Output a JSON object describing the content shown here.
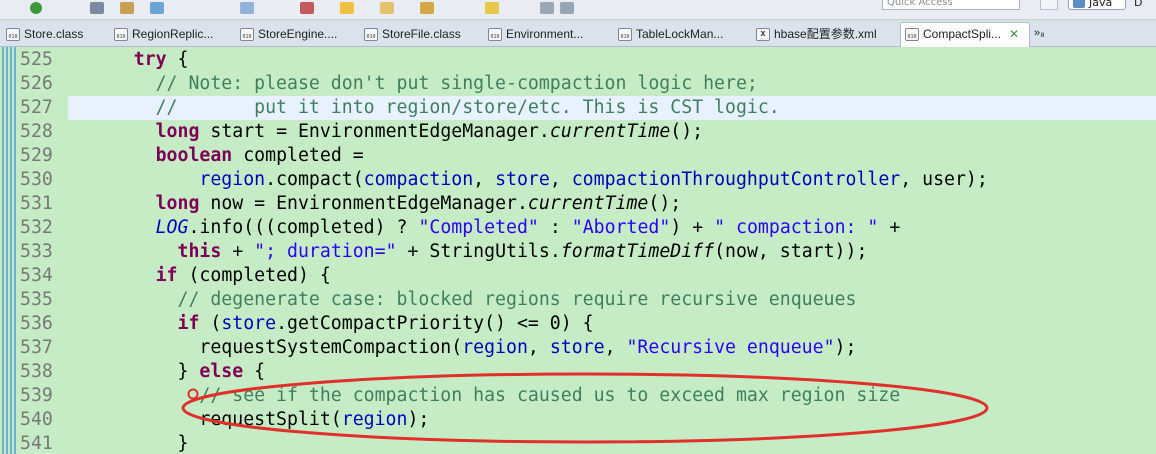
{
  "toolbar": {
    "quick_access_placeholder": "Quick Access",
    "perspective": "Java",
    "perspective_more": "D"
  },
  "tabs": [
    {
      "label": "Store.class",
      "icon": "class-file-icon",
      "active": false
    },
    {
      "label": "RegionReplic...",
      "icon": "class-file-icon",
      "active": false
    },
    {
      "label": "StoreEngine....",
      "icon": "class-file-icon",
      "active": false
    },
    {
      "label": "StoreFile.class",
      "icon": "class-file-icon",
      "active": false
    },
    {
      "label": "Environment...",
      "icon": "class-file-icon",
      "active": false
    },
    {
      "label": "TableLockMan...",
      "icon": "class-file-icon",
      "active": false
    },
    {
      "label": "hbase配置参数.xml",
      "icon": "xml-file-icon",
      "active": false
    },
    {
      "label": "CompactSpli...",
      "icon": "class-file-icon",
      "active": true
    }
  ],
  "tab_overflow": "»₈",
  "tab_icon_text": "010",
  "tab_close_glyph": "✕",
  "editor": {
    "current_line": 527,
    "lines": [
      {
        "n": "525",
        "segs": [
          [
            "pl",
            "      "
          ],
          [
            "kw",
            "try"
          ],
          [
            "pl",
            " {"
          ]
        ]
      },
      {
        "n": "526",
        "segs": [
          [
            "pl",
            "        "
          ],
          [
            "cm",
            "// Note: please don't put single-compaction logic here;"
          ]
        ]
      },
      {
        "n": "527",
        "segs": [
          [
            "pl",
            "        "
          ],
          [
            "cm",
            "//       put it into region/store/etc. This is CST logic."
          ]
        ]
      },
      {
        "n": "528",
        "segs": [
          [
            "pl",
            "        "
          ],
          [
            "kw",
            "long"
          ],
          [
            "pl",
            " start = EnvironmentEdgeManager."
          ],
          [
            "it",
            "currentTime"
          ],
          [
            "pl",
            "();"
          ]
        ]
      },
      {
        "n": "529",
        "segs": [
          [
            "pl",
            "        "
          ],
          [
            "kw",
            "boolean"
          ],
          [
            "pl",
            " completed ="
          ]
        ]
      },
      {
        "n": "530",
        "segs": [
          [
            "pl",
            "            "
          ],
          [
            "fld",
            "region"
          ],
          [
            "pl",
            ".compact("
          ],
          [
            "fld",
            "compaction"
          ],
          [
            "pl",
            ", "
          ],
          [
            "fld",
            "store"
          ],
          [
            "pl",
            ", "
          ],
          [
            "fld",
            "compactionThroughputController"
          ],
          [
            "pl",
            ", user);"
          ]
        ]
      },
      {
        "n": "531",
        "segs": [
          [
            "pl",
            "        "
          ],
          [
            "kw",
            "long"
          ],
          [
            "pl",
            " now = EnvironmentEdgeManager."
          ],
          [
            "it",
            "currentTime"
          ],
          [
            "pl",
            "();"
          ]
        ]
      },
      {
        "n": "532",
        "segs": [
          [
            "pl",
            "        "
          ],
          [
            "fldit",
            "LOG"
          ],
          [
            "pl",
            ".info((("
          ],
          [
            "pl",
            "completed) ? "
          ],
          [
            "st",
            "\"Completed\""
          ],
          [
            "pl",
            " : "
          ],
          [
            "st",
            "\"Aborted\""
          ],
          [
            "pl",
            ") + "
          ],
          [
            "st",
            "\" compaction: \""
          ],
          [
            "pl",
            " +"
          ]
        ]
      },
      {
        "n": "533",
        "segs": [
          [
            "pl",
            "          "
          ],
          [
            "kw",
            "this"
          ],
          [
            "pl",
            " + "
          ],
          [
            "st",
            "\"; duration=\""
          ],
          [
            "pl",
            " + StringUtils."
          ],
          [
            "it",
            "formatTimeDiff"
          ],
          [
            "pl",
            "(now, start));"
          ]
        ]
      },
      {
        "n": "534",
        "segs": [
          [
            "pl",
            "        "
          ],
          [
            "kw",
            "if"
          ],
          [
            "pl",
            " (completed) {"
          ]
        ]
      },
      {
        "n": "535",
        "segs": [
          [
            "pl",
            "          "
          ],
          [
            "cm",
            "// degenerate case: blocked regions require recursive enqueues"
          ]
        ]
      },
      {
        "n": "536",
        "segs": [
          [
            "pl",
            "          "
          ],
          [
            "kw",
            "if"
          ],
          [
            "pl",
            " ("
          ],
          [
            "fld",
            "store"
          ],
          [
            "pl",
            ".getCompactPriority() <= 0) {"
          ]
        ]
      },
      {
        "n": "537",
        "segs": [
          [
            "pl",
            "            requestSystemCompaction("
          ],
          [
            "fld",
            "region"
          ],
          [
            "pl",
            ", "
          ],
          [
            "fld",
            "store"
          ],
          [
            "pl",
            ", "
          ],
          [
            "st",
            "\"Recursive enqueue\""
          ],
          [
            "pl",
            ");"
          ]
        ]
      },
      {
        "n": "538",
        "segs": [
          [
            "pl",
            "          } "
          ],
          [
            "kw",
            "else"
          ],
          [
            "pl",
            " {"
          ]
        ]
      },
      {
        "n": "539",
        "segs": [
          [
            "pl",
            "            "
          ],
          [
            "cm",
            "// see if the compaction has caused us to exceed max region size"
          ]
        ]
      },
      {
        "n": "540",
        "segs": [
          [
            "pl",
            "            requestSplit("
          ],
          [
            "fld",
            "region"
          ],
          [
            "pl",
            ");"
          ]
        ]
      },
      {
        "n": "541",
        "segs": [
          [
            "pl",
            "          }"
          ]
        ]
      }
    ]
  },
  "colors": {
    "editor_background": "#c6ecc6",
    "keyword": "#7f0055",
    "comment": "#3f7f5f",
    "string": "#2a00ff",
    "field": "#0000c0",
    "line_number": "#787878",
    "current_line": "#e8f2fe",
    "annotation_ellipse": "#e0302a"
  }
}
